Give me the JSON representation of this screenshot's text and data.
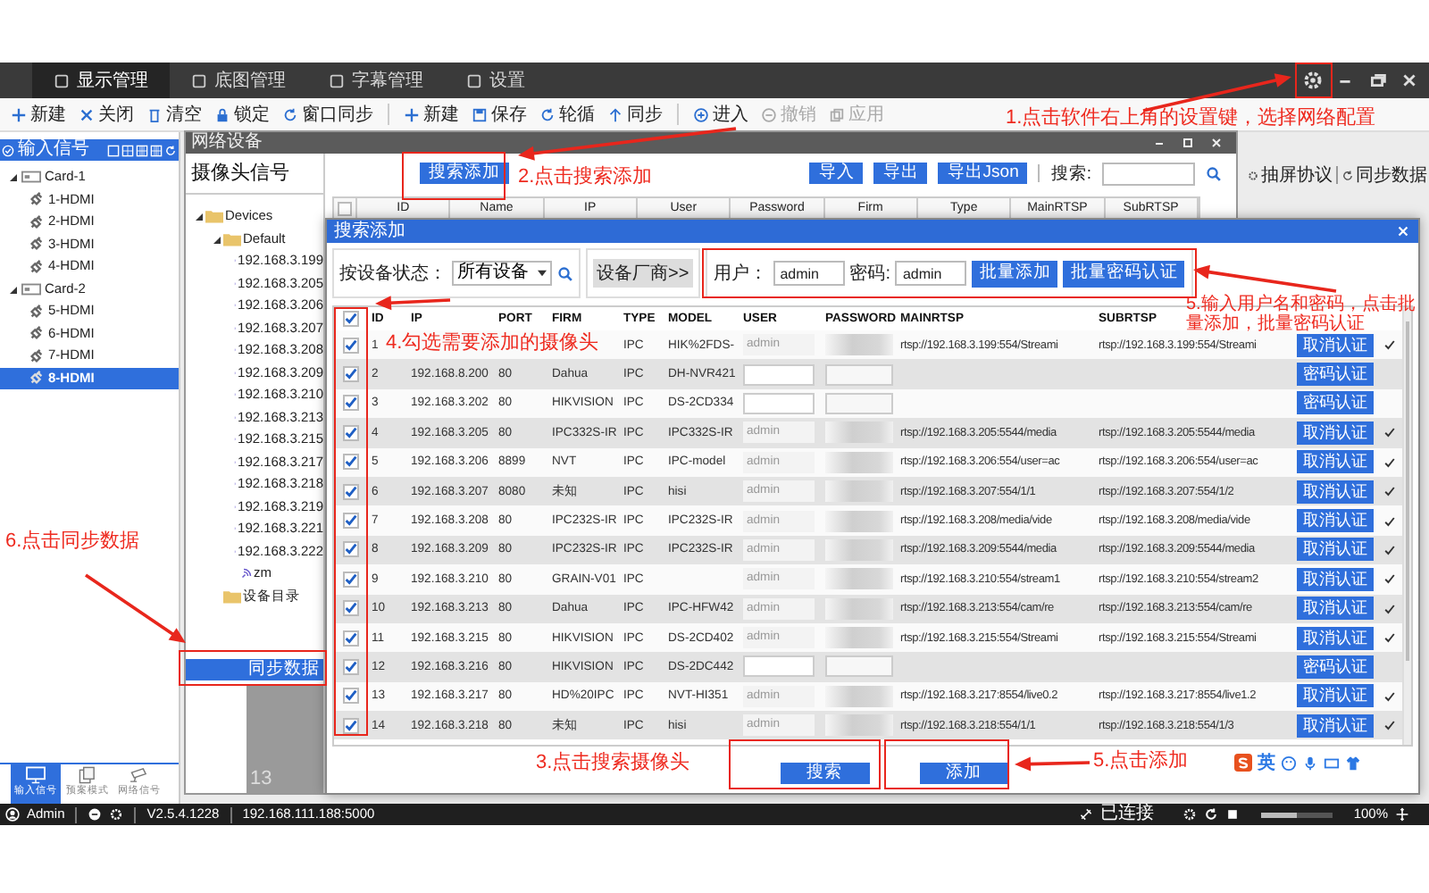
{
  "title_bar": {
    "tabs": [
      {
        "label": "显示管理",
        "selected": true
      },
      {
        "label": "底图管理",
        "selected": false
      },
      {
        "label": "字幕管理",
        "selected": false
      },
      {
        "label": "设置",
        "selected": false
      }
    ]
  },
  "toolbar": {
    "items": [
      {
        "label": "新建",
        "disabled": false
      },
      {
        "label": "关闭",
        "disabled": false
      },
      {
        "label": "清空",
        "disabled": false
      },
      {
        "label": "锁定",
        "disabled": false
      },
      {
        "label": "窗口同步",
        "disabled": false
      },
      {
        "label": "新建",
        "disabled": false
      },
      {
        "label": "保存",
        "disabled": false
      },
      {
        "label": "轮循",
        "disabled": false
      },
      {
        "label": "同步",
        "disabled": false
      },
      {
        "label": "进入",
        "disabled": false
      },
      {
        "label": "撤销",
        "disabled": true
      },
      {
        "label": "应用",
        "disabled": true
      }
    ]
  },
  "input_panel": {
    "title": "输入信号",
    "tree": [
      {
        "label": "Card-1",
        "expanded": true,
        "children": [
          {
            "label": "1-HDMI",
            "selected": false
          },
          {
            "label": "2-HDMI",
            "selected": false
          },
          {
            "label": "3-HDMI",
            "selected": false
          },
          {
            "label": "4-HDMI",
            "selected": false
          }
        ]
      },
      {
        "label": "Card-2",
        "expanded": true,
        "children": [
          {
            "label": "5-HDMI",
            "selected": false
          },
          {
            "label": "6-HDMI",
            "selected": false
          },
          {
            "label": "7-HDMI",
            "selected": false
          },
          {
            "label": "8-HDMI",
            "selected": true
          }
        ]
      }
    ]
  },
  "bottom_nav": [
    {
      "label": "输入信号",
      "selected": true
    },
    {
      "label": "预案模式",
      "selected": false
    },
    {
      "label": "网络信号",
      "selected": false
    }
  ],
  "background_toolbar": [
    "抽屏协议",
    "同步数据"
  ],
  "preview_tile": {
    "label": "13"
  },
  "network_window": {
    "title": "网络设备",
    "heading": "摄像头信号",
    "tree": [
      {
        "label": "Devices",
        "kind": "folder",
        "expanded": true,
        "children": [
          {
            "label": "Default",
            "kind": "folder",
            "expanded": true,
            "children": [
              {
                "label": "192.168.3.199",
                "kind": "camera"
              },
              {
                "label": "192.168.3.205",
                "kind": "camera"
              },
              {
                "label": "192.168.3.206",
                "kind": "camera"
              },
              {
                "label": "192.168.3.207",
                "kind": "camera"
              },
              {
                "label": "192.168.3.208",
                "kind": "camera"
              },
              {
                "label": "192.168.3.209",
                "kind": "camera"
              },
              {
                "label": "192.168.3.210",
                "kind": "camera"
              },
              {
                "label": "192.168.3.213",
                "kind": "camera"
              },
              {
                "label": "192.168.3.215",
                "kind": "camera"
              },
              {
                "label": "192.168.3.217",
                "kind": "camera"
              },
              {
                "label": "192.168.3.218",
                "kind": "camera"
              },
              {
                "label": "192.168.3.219",
                "kind": "camera"
              },
              {
                "label": "192.168.3.221",
                "kind": "camera"
              },
              {
                "label": "192.168.3.222",
                "kind": "camera"
              },
              {
                "label": "zm",
                "kind": "camera"
              }
            ]
          },
          {
            "label": "设备目录",
            "kind": "folder"
          }
        ]
      }
    ],
    "header_checked": false,
    "sync_button": "同步数据",
    "search_add_button": "搜索添加",
    "right_buttons": [
      "导入",
      "导出",
      "导出Json"
    ],
    "search_label": "搜索:",
    "columns": [
      "ID",
      "Name",
      "IP",
      "User",
      "Password",
      "Firm",
      "Type",
      "MainRTSP",
      "SubRTSP"
    ]
  },
  "search_dialog": {
    "title": "搜索添加",
    "status_label": "按设备状态：",
    "status_value": "所有设备",
    "vendor_button": "设备厂商>>",
    "user_label": "用户：",
    "user_value": "admin",
    "password_label": "密码:",
    "password_value": "admin",
    "batch_add_button": "批量添加",
    "batch_auth_button": "批量密码认证",
    "all_checked": true,
    "columns": [
      "ID",
      "IP",
      "PORT",
      "FIRM",
      "TYPE",
      "MODEL",
      "USER",
      "PASSWORD",
      "MAINRTSP",
      "SUBRTSP"
    ],
    "rows": [
      {
        "checked": true,
        "id": "1",
        "type": "IPC",
        "model": "HIK%2FDS-",
        "user": "admin",
        "password_masked": true,
        "main_rtsp": "rtsp://192.168.3.199:554/Streami",
        "sub_rtsp": "rtsp://192.168.3.199:554/Streami",
        "action": "取消认证",
        "verified": true
      },
      {
        "checked": true,
        "id": "2",
        "ip": "192.168.8.200",
        "port": "80",
        "firm": "Dahua",
        "type": "IPC",
        "model": "DH-NVR421",
        "password_masked": false,
        "action": "密码认证",
        "verified": false
      },
      {
        "checked": true,
        "id": "3",
        "ip": "192.168.3.202",
        "port": "80",
        "firm": "HIKVISION",
        "type": "IPC",
        "model": "DS-2CD334",
        "password_masked": false,
        "action": "密码认证",
        "verified": false
      },
      {
        "checked": true,
        "id": "4",
        "ip": "192.168.3.205",
        "port": "80",
        "firm": "IPC332S-IR",
        "type": "IPC",
        "model": "IPC332S-IR",
        "user": "admin",
        "password_masked": true,
        "main_rtsp": "rtsp://192.168.3.205:5544/media",
        "sub_rtsp": "rtsp://192.168.3.205:5544/media",
        "action": "取消认证",
        "verified": true
      },
      {
        "checked": true,
        "id": "5",
        "ip": "192.168.3.206",
        "port": "8899",
        "firm": "NVT",
        "type": "IPC",
        "model": "IPC-model",
        "user": "admin",
        "password_masked": true,
        "main_rtsp": "rtsp://192.168.3.206:554/user=ac",
        "sub_rtsp": "rtsp://192.168.3.206:554/user=ac",
        "action": "取消认证",
        "verified": true
      },
      {
        "checked": true,
        "id": "6",
        "ip": "192.168.3.207",
        "port": "8080",
        "firm": "未知",
        "type": "IPC",
        "model": "hisi",
        "user": "admin",
        "password_masked": true,
        "main_rtsp": "rtsp://192.168.3.207:554/1/1",
        "sub_rtsp": "rtsp://192.168.3.207:554/1/2",
        "action": "取消认证",
        "verified": true
      },
      {
        "checked": true,
        "id": "7",
        "ip": "192.168.3.208",
        "port": "80",
        "firm": "IPC232S-IR",
        "type": "IPC",
        "model": "IPC232S-IR",
        "user": "admin",
        "password_masked": true,
        "main_rtsp": "rtsp://192.168.3.208/media/vide",
        "sub_rtsp": "rtsp://192.168.3.208/media/vide",
        "action": "取消认证",
        "verified": true
      },
      {
        "checked": true,
        "id": "8",
        "ip": "192.168.3.209",
        "port": "80",
        "firm": "IPC232S-IR",
        "type": "IPC",
        "model": "IPC232S-IR",
        "user": "admin",
        "password_masked": true,
        "main_rtsp": "rtsp://192.168.3.209:5544/media",
        "sub_rtsp": "rtsp://192.168.3.209:5544/media",
        "action": "取消认证",
        "verified": true
      },
      {
        "checked": true,
        "id": "9",
        "ip": "192.168.3.210",
        "port": "80",
        "firm": "GRAIN-V01",
        "type": "IPC",
        "user": "admin",
        "password_masked": true,
        "main_rtsp": "rtsp://192.168.3.210:554/stream1",
        "sub_rtsp": "rtsp://192.168.3.210:554/stream2",
        "action": "取消认证",
        "verified": true
      },
      {
        "checked": true,
        "id": "10",
        "ip": "192.168.3.213",
        "port": "80",
        "firm": "Dahua",
        "type": "IPC",
        "model": "IPC-HFW42",
        "user": "admin",
        "password_masked": true,
        "main_rtsp": "rtsp://192.168.3.213:554/cam/re",
        "sub_rtsp": "rtsp://192.168.3.213:554/cam/re",
        "action": "取消认证",
        "verified": true
      },
      {
        "checked": true,
        "id": "11",
        "ip": "192.168.3.215",
        "port": "80",
        "firm": "HIKVISION",
        "type": "IPC",
        "model": "DS-2CD402",
        "user": "admin",
        "password_masked": true,
        "main_rtsp": "rtsp://192.168.3.215:554/Streami",
        "sub_rtsp": "rtsp://192.168.3.215:554/Streami",
        "action": "取消认证",
        "verified": true
      },
      {
        "checked": true,
        "id": "12",
        "ip": "192.168.3.216",
        "port": "80",
        "firm": "HIKVISION",
        "type": "IPC",
        "model": "DS-2DC442",
        "password_masked": false,
        "action": "密码认证",
        "verified": false
      },
      {
        "checked": true,
        "id": "13",
        "ip": "192.168.3.217",
        "port": "80",
        "firm": "HD%20IPC",
        "type": "IPC",
        "model": "NVT-HI351",
        "user": "admin",
        "password_masked": true,
        "main_rtsp": "rtsp://192.168.3.217:8554/live0.2",
        "sub_rtsp": "rtsp://192.168.3.217:8554/live1.2",
        "action": "取消认证",
        "verified": true
      },
      {
        "checked": true,
        "id": "14",
        "ip": "192.168.3.218",
        "port": "80",
        "firm": "未知",
        "type": "IPC",
        "model": "hisi",
        "user": "admin",
        "password_masked": true,
        "main_rtsp": "rtsp://192.168.3.218:554/1/1",
        "sub_rtsp": "rtsp://192.168.3.218:554/1/3",
        "action": "取消认证",
        "verified": true
      }
    ],
    "search_button": "搜索",
    "add_button": "添加"
  },
  "status_bar": {
    "user": "Admin",
    "version": "V2.5.4.1228",
    "address": "192.168.111.188:5000",
    "connection": "已连接",
    "zoom_slider": {
      "level": 0.5
    },
    "zoom": "100%"
  },
  "ime_bar": {
    "label": "英"
  },
  "annotations": [
    {
      "text": "1.点击软件右上角的设置键，选择网络配置"
    },
    {
      "text": "2.点击搜索添加"
    },
    {
      "text": "3.点击搜索摄像头"
    },
    {
      "text": "4.勾选需要添加的摄像头"
    },
    {
      "text": "5.输入用户名和密码，点击批量添加，批量密码认证"
    },
    {
      "text": "5.点击添加"
    },
    {
      "text": "6.点击同步数据"
    }
  ]
}
